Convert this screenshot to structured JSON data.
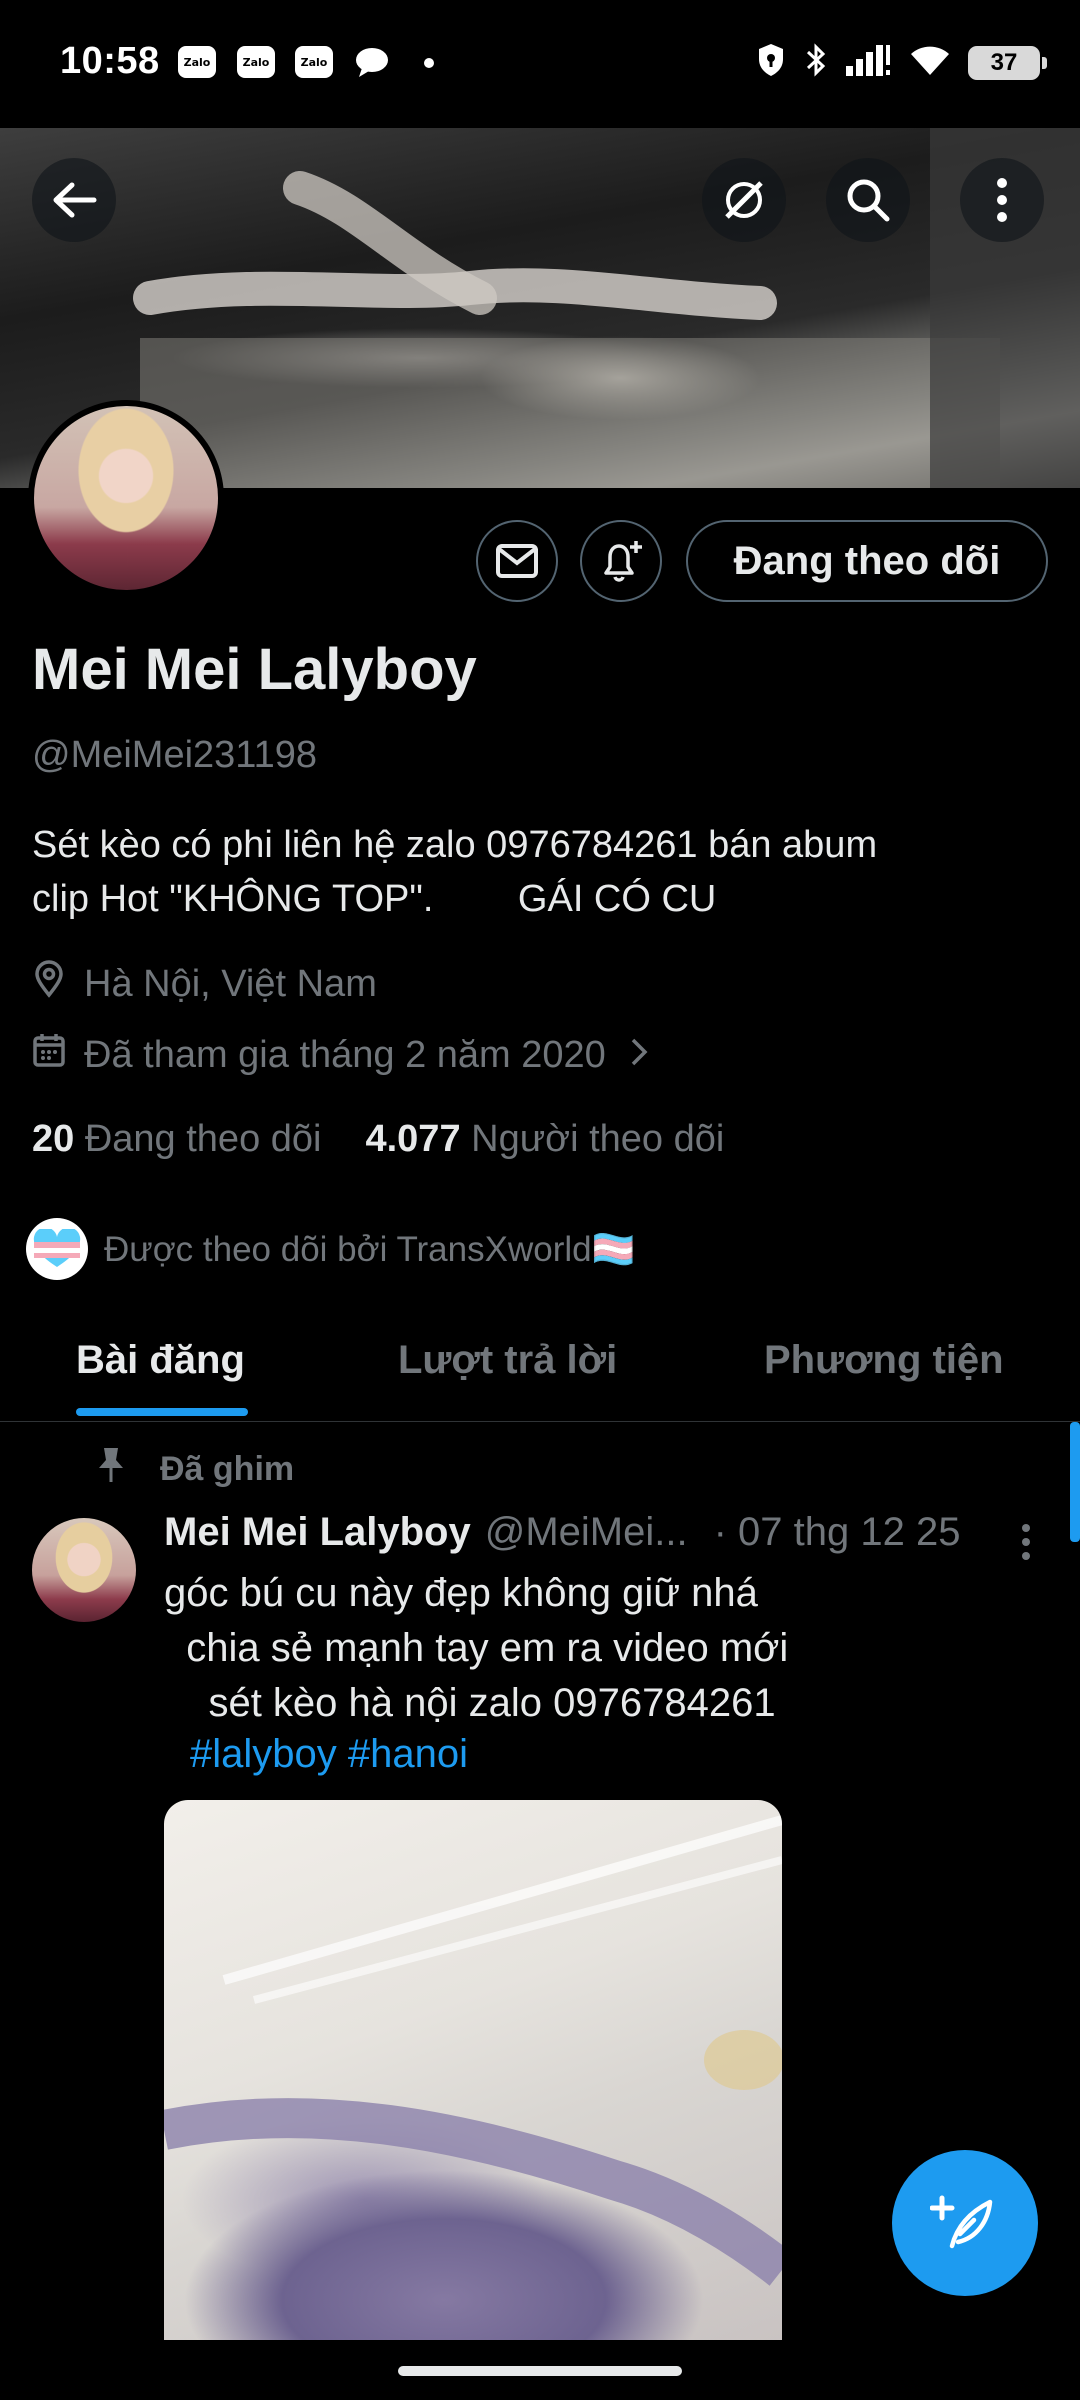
{
  "status_bar": {
    "time": "10:58",
    "zalo_label": "Zalo",
    "battery": "37"
  },
  "profile": {
    "name": "Mei Mei Lalyboy",
    "handle": "@MeiMei231198",
    "bio": "Sét kèo có phi liên hệ zalo 0976784261 bán abum\nclip Hot \"KHÔNG TOP\".        GÁI CÓ CU",
    "location": "Hà Nội, Việt Nam",
    "joined": "Đã tham gia tháng 2 năm 2020",
    "following_count": "20",
    "following_label": "Đang theo dõi",
    "followers_count": "4.077",
    "followers_label": "Người theo dõi",
    "followed_by": "Được theo dõi bởi TransXworld🏳️‍⚧️",
    "follow_button": "Đang theo dõi"
  },
  "tabs": [
    {
      "label": "Bài đăng",
      "active": true
    },
    {
      "label": "Lượt trả lời",
      "active": false
    },
    {
      "label": "Phương tiện",
      "active": false
    }
  ],
  "pinned_post": {
    "pinned_label": "Đã ghim",
    "author_name": "Mei Mei Lalyboy",
    "author_handle": "@MeiMei...",
    "date": "· 07 thg 12 25",
    "text": "góc bú cu này đẹp không giữ nhá\n  chia sẻ mạnh tay em ra video mới\n    sét kèo hà nội zalo 0976784261",
    "hashtags": "#lalyboy #hanoi"
  },
  "colors": {
    "accent": "#1d9bf0",
    "text_primary": "#e7e9ea",
    "text_secondary": "#71767b",
    "border": "#2f3336"
  }
}
